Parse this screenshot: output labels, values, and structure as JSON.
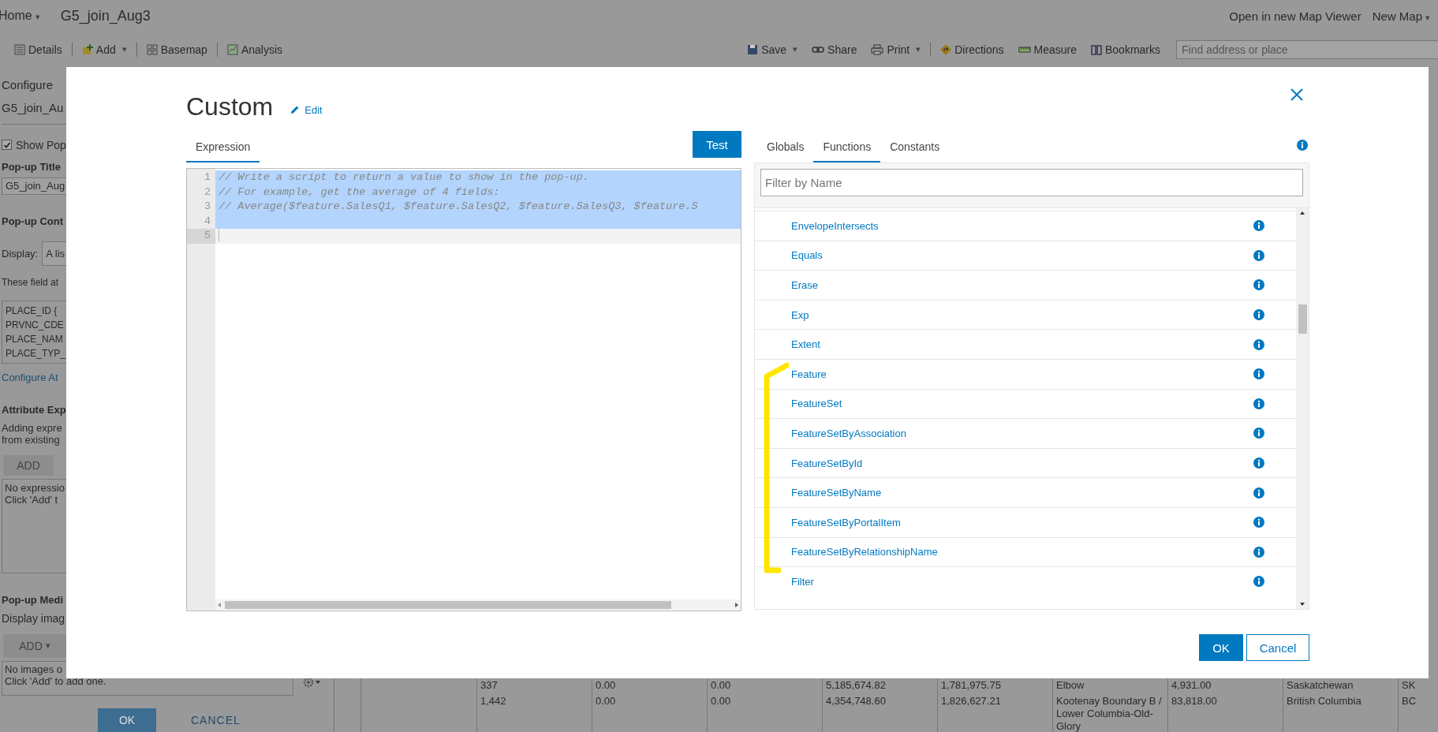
{
  "top_bar": {
    "home": "Home",
    "home_caret": "▾",
    "title": "G5_join_Aug3",
    "links": [
      {
        "label": "Open in new Map Viewer"
      },
      {
        "label": "New Map",
        "caret": "▾"
      }
    ]
  },
  "toolbar": {
    "left": [
      {
        "label": "Details"
      },
      {
        "label": "Add",
        "caret": "▾"
      },
      {
        "label": "Basemap"
      },
      {
        "label": "Analysis"
      }
    ],
    "right": [
      {
        "label": "Save",
        "caret": "▾"
      },
      {
        "label": "Share"
      },
      {
        "label": "Print",
        "caret": "▾"
      },
      {
        "label": "Directions"
      },
      {
        "label": "Measure"
      },
      {
        "label": "Bookmarks"
      }
    ],
    "search": {
      "placeholder": "Find address or place"
    }
  },
  "left_panel": {
    "heading": "Configure",
    "layer_name": "G5_join_Au",
    "show_popup": {
      "label": "Show Pop",
      "checked": true
    },
    "title_label": "Pop-up Title",
    "title_value": "G5_join_Aug",
    "content_label": "Pop-up Cont",
    "display_label": "Display:",
    "display_value": "A lis",
    "fields_note": "These field at",
    "fields": [
      "PLACE_ID {",
      "PRVNC_CDE",
      "PLACE_NAM",
      "PLACE_TYP_"
    ],
    "configure_link": "Configure At",
    "expressions_label": "Attribute Exp",
    "expressions_note": [
      "Adding expre",
      "from existing"
    ],
    "add_expression": "ADD",
    "expressions_empty": [
      "No expressio",
      "Click 'Add' t"
    ],
    "media_label": "Pop-up Medi",
    "media_note": "Display imag",
    "add_media": "ADD",
    "add_media_caret": "▾",
    "media_empty": [
      "No images o",
      "Click 'Add' to add one."
    ],
    "ok": "OK",
    "cancel": "CANCEL"
  },
  "table": {
    "rows": [
      [
        "337",
        "0.00",
        "0.00",
        "5,185,674.82",
        "1,781,975.75",
        "Elbow",
        "4,931.00",
        "Saskatchewan",
        "SK"
      ],
      [
        "1,442",
        "0.00",
        "0.00",
        "4,354,748.60",
        "1,826,627.21",
        "Kootenay Boundary B / Lower Columbia-Old-Glory",
        "83,818.00",
        "British Columbia",
        "BC"
      ]
    ]
  },
  "dialog": {
    "title": "Custom",
    "edit": "Edit",
    "editor_tabs": [
      {
        "label": "Expression",
        "selected": true
      }
    ],
    "test": "Test",
    "code_lines": [
      {
        "number": "1",
        "text": "// Write a script to return a value to show in the pop-up.",
        "selected": true,
        "current": false
      },
      {
        "number": "2",
        "text": "// For example, get the average of 4 fields:",
        "selected": true,
        "current": false
      },
      {
        "number": "3",
        "text": "// Average($feature.SalesQ1, $feature.SalesQ2, $feature.SalesQ3, $feature.S",
        "selected": true,
        "current": false
      },
      {
        "number": "4",
        "selected": true,
        "current": false
      },
      {
        "number": "5",
        "selected": false,
        "current": true
      }
    ],
    "reference_tabs": [
      {
        "label": "Globals",
        "selected": false
      },
      {
        "label": "Functions",
        "selected": true
      },
      {
        "label": "Constants",
        "selected": false
      }
    ],
    "filter": {
      "placeholder": "Filter by Name"
    },
    "functions": [
      "EnvelopeIntersects",
      "Equals",
      "Erase",
      "Exp",
      "Extent",
      "Feature",
      "FeatureSet",
      "FeatureSetByAssociation",
      "FeatureSetById",
      "FeatureSetByName",
      "FeatureSetByPortalItem",
      "FeatureSetByRelationshipName",
      "Filter"
    ],
    "ok": "OK",
    "cancel": "Cancel"
  }
}
